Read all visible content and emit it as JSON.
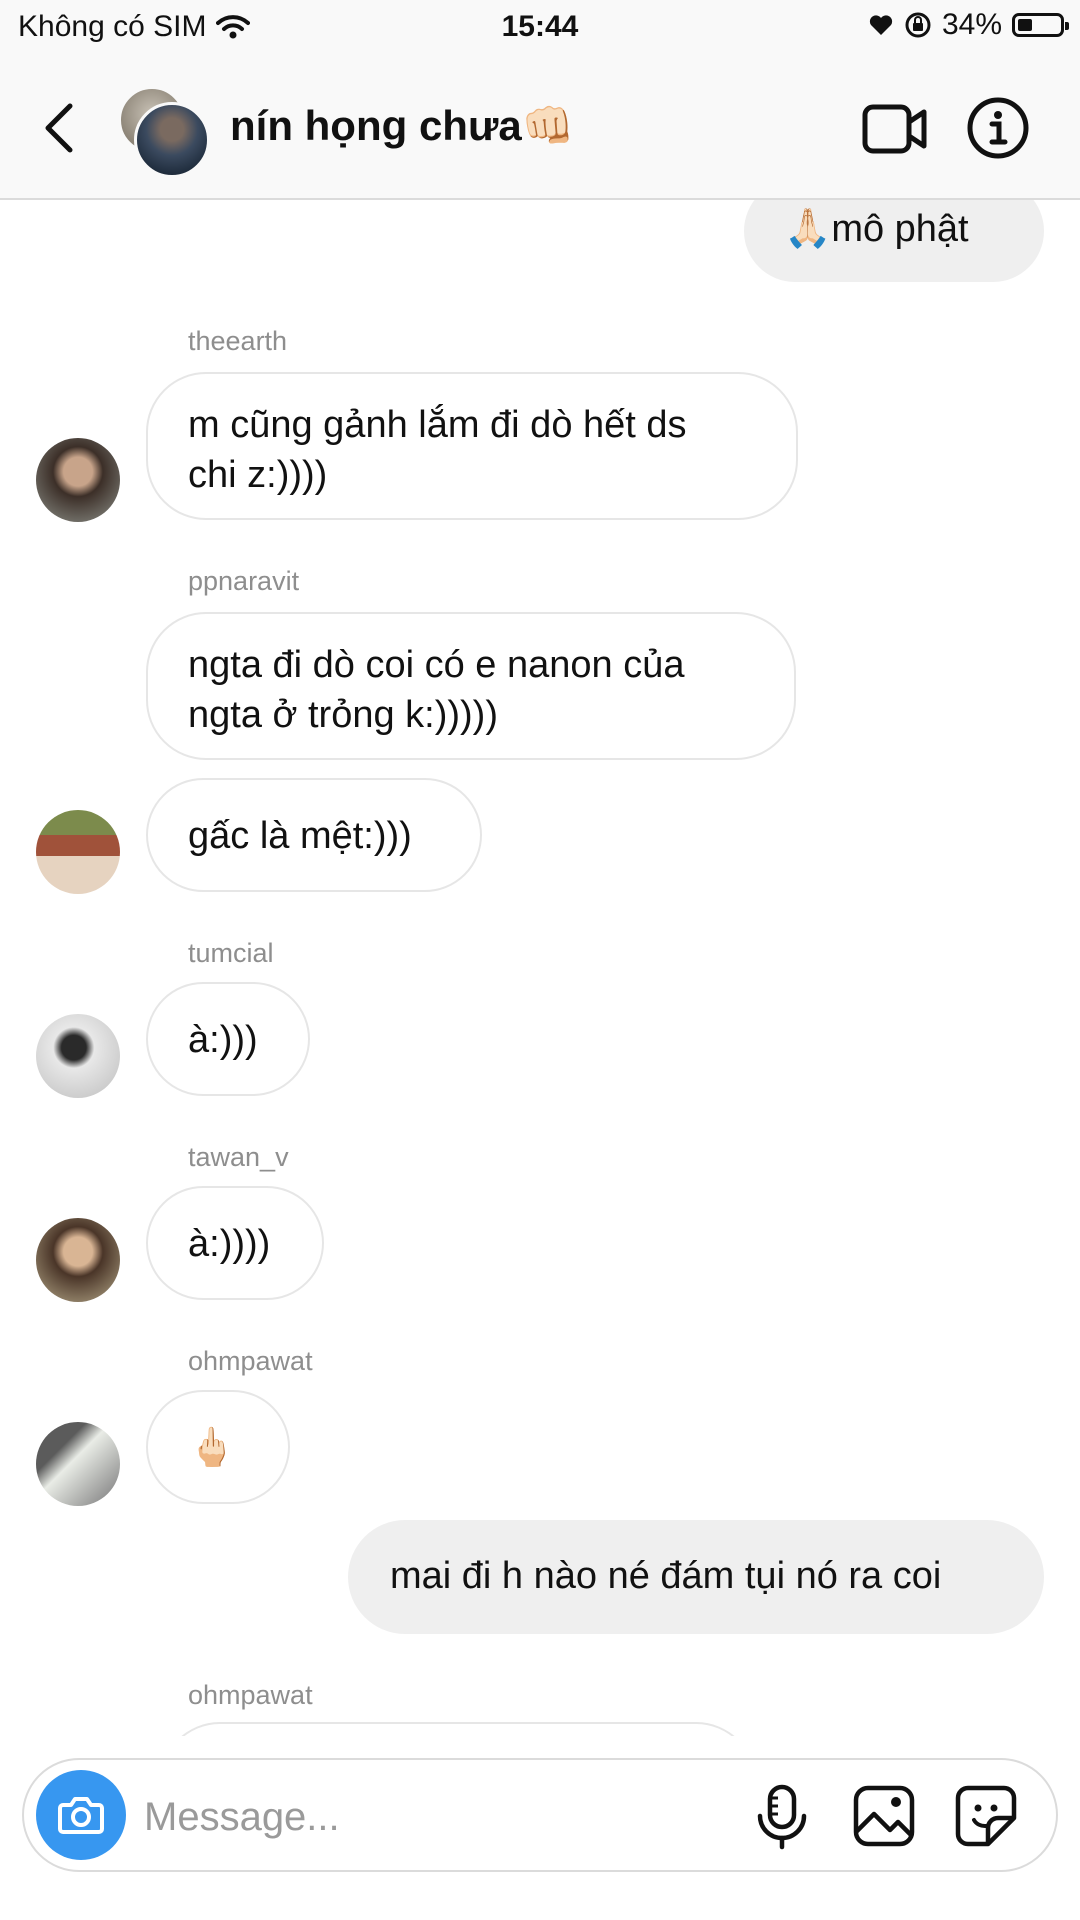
{
  "status_bar": {
    "carrier": "Không có SIM",
    "time": "15:44",
    "battery": "34%",
    "icons": [
      "wifi-icon",
      "heart-icon",
      "orientation-lock-icon",
      "battery-icon"
    ]
  },
  "header": {
    "title": "nín họng chưa👊🏻",
    "icons": [
      "back-chevron-icon",
      "video-call-icon",
      "info-icon"
    ]
  },
  "messages": [
    {
      "type": "outgoing",
      "text": "🙏🏻mô phật"
    },
    {
      "type": "sender",
      "text": "theearth"
    },
    {
      "type": "incoming",
      "lines": [
        "m cũng gảnh lắm đi dò hết ds",
        "chi z:))))"
      ]
    },
    {
      "type": "sender",
      "text": "ppnaravit"
    },
    {
      "type": "incoming",
      "lines": [
        "ngta đi dò coi có e nanon của",
        "ngta ở trỏng k:)))))"
      ]
    },
    {
      "type": "incoming",
      "text": "gấc là mệt:)))"
    },
    {
      "type": "sender",
      "text": "tumcial"
    },
    {
      "type": "incoming",
      "text": "à:)))"
    },
    {
      "type": "sender",
      "text": "tawan_v"
    },
    {
      "type": "incoming",
      "text": "à:))))"
    },
    {
      "type": "sender",
      "text": "ohmpawat"
    },
    {
      "type": "incoming",
      "text": "🖕🏻"
    },
    {
      "type": "outgoing",
      "text": "mai đi h nào né đám tụi nó ra coi"
    },
    {
      "type": "sender",
      "text": "ohmpawat"
    }
  ],
  "composer": {
    "placeholder": "Message...",
    "icons": [
      "camera-icon",
      "microphone-icon",
      "gallery-icon",
      "sticker-icon"
    ]
  },
  "colors": {
    "accent": "#3797f0",
    "incoming_border": "#e6e6e6",
    "outgoing_bg": "#efefef",
    "sender_text": "#8e8e8e"
  }
}
